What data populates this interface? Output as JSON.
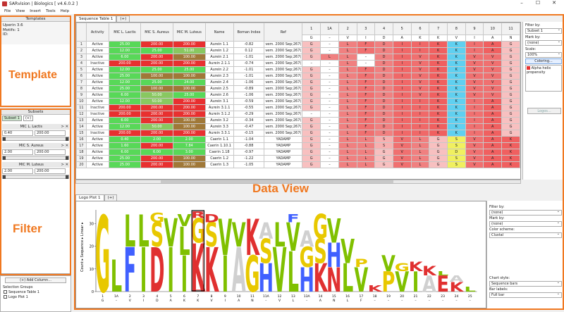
{
  "window": {
    "title": "SARvision | Biologics [ v4.6.0.2 ]",
    "min": "–",
    "max": "☐",
    "close": "✕"
  },
  "menu": [
    "File",
    "View",
    "Insert",
    "Tools",
    "Help"
  ],
  "templates": {
    "header": "Templates",
    "lines": [
      "Uperin 3.6",
      "Motifs: 1",
      "ID:"
    ]
  },
  "subsets": {
    "header": "Subsets",
    "active": "Subset 1",
    "plus": "(+)",
    "filters": [
      {
        "label": "MIC L. Lactis",
        "min": "0.40",
        "max": "200.00",
        "lo": 0.0,
        "hi": 1.0
      },
      {
        "label": "MIC S. Aureus",
        "min": "2.00",
        "max": "200.00",
        "lo": 0.0,
        "hi": 1.0
      },
      {
        "label": "MIC M. Luteus",
        "min": "2.00",
        "max": "200.00",
        "lo": 0.0,
        "hi": 1.0
      }
    ]
  },
  "add_column": "(+) Add Column...",
  "selection": {
    "header": "Selection Groups",
    "items": [
      "Sequence Table 1",
      "Logo Plot 1"
    ]
  },
  "annotations": {
    "template": "Template",
    "filter": "Filter",
    "dataview": "Data View"
  },
  "table_tab": "Sequence Table 1",
  "table_plus": "(+)",
  "table": {
    "headers": [
      "Activity",
      "MIC L. Lactis",
      "MIC S. Aureus",
      "MIC M. Luteus",
      "Name",
      "Boman Index",
      "Ref"
    ],
    "pos": [
      "1",
      "1A",
      "2",
      "3",
      "4",
      "5",
      "6",
      "7",
      "8",
      "9",
      "10",
      "11"
    ],
    "consensus": [
      "G",
      "–",
      "V",
      "I",
      "D",
      "A",
      "K",
      "K",
      "V",
      "I",
      "A",
      "N"
    ],
    "rows": [
      [
        "1",
        "Active",
        "25.00",
        "200.00",
        "200.00",
        "Aurein 1.1",
        "-0.82",
        "vem. 2000 Sep;267(",
        "G",
        "–",
        "L",
        "F",
        "D",
        "I",
        "I",
        "K",
        "K",
        "I",
        "A",
        "G"
      ],
      [
        "2",
        "Active",
        "12.00",
        "25.00",
        "51.00",
        "Aurein 1.2",
        "0.12",
        "vem. 2000 Sep;267(",
        "G",
        "–",
        "L",
        "F",
        "D",
        "I",
        "I",
        "K",
        "K",
        "I",
        "A",
        "G"
      ],
      [
        "3",
        "Active",
        "6.00",
        "200.00",
        "100.00",
        "Aurein 2.1",
        "-1.01",
        "vem. 2000 Sep;267(",
        "G",
        "L",
        "L",
        "–",
        "D",
        "I",
        "V",
        "K",
        "K",
        "V",
        "V",
        "G"
      ],
      [
        "4",
        "Inactive",
        "200.00",
        "200.00",
        "200.00",
        "Aurein 2.1.1",
        "-0.74",
        "vem. 2000 Sep;267(",
        "–",
        "–",
        "L",
        "–",
        "D",
        "I",
        "V",
        "K",
        "K",
        "V",
        "V",
        "G"
      ],
      [
        "5",
        "Active",
        "12.00",
        "25.00",
        "25.00",
        "Aurein 2.2",
        "-1.01",
        "vem. 2000 Sep;267(",
        "G",
        "–",
        "L",
        "F",
        "D",
        "I",
        "V",
        "K",
        "K",
        "V",
        "V",
        "G"
      ],
      [
        "6",
        "Active",
        "25.00",
        "100.00",
        "100.00",
        "Aurein 2.3",
        "-1.01",
        "vem. 2000 Sep;267(",
        "G",
        "–",
        "L",
        "F",
        "D",
        "I",
        "V",
        "K",
        "K",
        "V",
        "V",
        "G"
      ],
      [
        "7",
        "Active",
        "12.00",
        "25.00",
        "24.00",
        "Aurein 2.4",
        "-1.06",
        "vem. 2000 Sep;267(",
        "G",
        "–",
        "L",
        "F",
        "D",
        "I",
        "V",
        "K",
        "K",
        "V",
        "V",
        "G"
      ],
      [
        "8",
        "Active",
        "25.00",
        "100.00",
        "100.00",
        "Aurein 2.5",
        "-0.89",
        "vem. 2000 Sep;267(",
        "G",
        "–",
        "L",
        "F",
        "D",
        "I",
        "V",
        "K",
        "K",
        "V",
        "V",
        "G"
      ],
      [
        "9",
        "Active",
        "6.00",
        "50.00",
        "25.00",
        "Aurein 2.6",
        "-1.06",
        "vem. 2000 Sep;267(",
        "G",
        "–",
        "L",
        "F",
        "D",
        "I",
        "V",
        "K",
        "K",
        "V",
        "V",
        "G"
      ],
      [
        "10",
        "Active",
        "12.00",
        "50.00",
        "200.00",
        "Aurein 3.1",
        "-0.59",
        "vem. 2000 Sep;267(",
        "G",
        "–",
        "L",
        "F",
        "D",
        "I",
        "I",
        "K",
        "K",
        "I",
        "A",
        "G"
      ],
      [
        "11",
        "Inactive",
        "200.00",
        "200.00",
        "200.00",
        "Aurein 3.1.1",
        "-0.55",
        "vem. 2000 Sep;267(",
        "G",
        "–",
        "L",
        "F",
        "D",
        "I",
        "I",
        "K",
        "K",
        "I",
        "A",
        "G"
      ],
      [
        "12",
        "Inactive",
        "200.00",
        "200.00",
        "200.00",
        "Aurein 3.1.2",
        "-0.29",
        "vem. 2000 Sep;267(",
        "–",
        "–",
        "L",
        "F",
        "D",
        "I",
        "I",
        "K",
        "K",
        "I",
        "A",
        "G"
      ],
      [
        "13",
        "Active",
        "6.00",
        "200.00",
        "100.00",
        "Aurein 3.2",
        "-0.34",
        "vem. 2000 Sep;267(",
        "G",
        "–",
        "L",
        "F",
        "D",
        "I",
        "I",
        "K",
        "K",
        "I",
        "A",
        "G"
      ],
      [
        "14",
        "Active",
        "12.00",
        "50.00",
        "100.00",
        "Aurein 3.3",
        "-0.47",
        "vem. 2000 Sep;267(",
        "G",
        "–",
        "L",
        "F",
        "D",
        "I",
        "I",
        "K",
        "K",
        "I",
        "A",
        "G"
      ],
      [
        "15",
        "Inactive",
        "200.00",
        "200.00",
        "200.00",
        "Aurein 3.3.1",
        "-0.15",
        "vem. 2000 Sep;267(",
        "G",
        "–",
        "L",
        "F",
        "D",
        "I",
        "I",
        "K",
        "K",
        "I",
        "A",
        "G"
      ],
      [
        "16",
        "Active",
        "0.40",
        "2.00",
        "2.00",
        "Caerin 1.1",
        "-1.04",
        "YADAMP",
        "G",
        "–",
        "L",
        "L",
        "S",
        "V",
        "L",
        "G",
        "S",
        "V",
        "A",
        "K"
      ],
      [
        "17",
        "Active",
        "1.60",
        "200.00",
        "7.84",
        "Caerin 1.10.1",
        "-0.88",
        "YADAMP",
        "G",
        "–",
        "L",
        "L",
        "S",
        "V",
        "L",
        "G",
        "S",
        "V",
        "A",
        "K"
      ],
      [
        "18",
        "Active",
        "6.00",
        "6.00",
        "3.00",
        "Caerin 1.18",
        "-0.97",
        "YADAMP",
        "G",
        "–",
        "L",
        "L",
        "G",
        "V",
        "L",
        "G",
        "D",
        "V",
        "A",
        "K"
      ],
      [
        "19",
        "Active",
        "25.00",
        "200.00",
        "100.00",
        "Caerin 1.2",
        "-1.22",
        "YADAMP",
        "G",
        "–",
        "L",
        "L",
        "G",
        "V",
        "L",
        "G",
        "S",
        "V",
        "A",
        "K"
      ],
      [
        "20",
        "Active",
        "25.00",
        "200.00",
        "100.00",
        "Caerin 1.3",
        "-1.05",
        "YADAMP",
        "G",
        "–",
        "L",
        "L",
        "G",
        "V",
        "L",
        "G",
        "S",
        "V",
        "A",
        "K"
      ]
    ]
  },
  "table_panel": {
    "filter_by": "Filter by:",
    "subset": "Subset 1",
    "mark_by": "Mark by:",
    "mark": "(none)",
    "scale": "Scale:",
    "scale_val": "100%",
    "coloring": "Coloring...",
    "legend": "Alpha helix propensity",
    "logos": "Logos..."
  },
  "logo_tab": "Logo Plot 1",
  "logo_plus": "(+)",
  "logo": {
    "ylabel": "Count ▸ Sequence ▸ Linear ▸",
    "yticks": [
      "0",
      "10",
      "20",
      "30"
    ],
    "positions": [
      "1",
      "1A",
      "2",
      "3",
      "4",
      "5",
      "6",
      "7",
      "8",
      "9",
      "10",
      "11",
      "11A",
      "12",
      "13",
      "13A",
      "14",
      "15",
      "16",
      "17",
      "18",
      "19",
      "20",
      "21",
      "22",
      "23",
      "24",
      "25"
    ],
    "consensus": [
      "G",
      "–",
      "V",
      "I",
      "D",
      "A",
      "K",
      "K",
      "V",
      "I",
      "A",
      "N",
      "–",
      "V",
      "L",
      "–",
      "A",
      "N",
      "L",
      "F",
      "–",
      "–",
      "–",
      "–",
      "–",
      "–",
      "–",
      "–"
    ],
    "columns": [
      [
        [
          "G",
          0.95,
          "#e8c800"
        ]
      ],
      [
        [
          "L",
          0.4,
          "#80c000"
        ]
      ],
      [
        [
          "F",
          0.55,
          "#4060ff"
        ],
        [
          "L",
          0.4,
          "#80c000"
        ]
      ],
      [
        [
          "I",
          0.55,
          "#80c000"
        ],
        [
          "L",
          0.4,
          "#80c000"
        ]
      ],
      [
        [
          "D",
          0.55,
          "#e03030"
        ],
        [
          "S",
          0.3,
          "#e8c800"
        ],
        [
          "G",
          0.12,
          "#e8c800"
        ]
      ],
      [
        [
          "I",
          0.55,
          "#80c000"
        ],
        [
          "V",
          0.35,
          "#80c000"
        ]
      ],
      [
        [
          "I",
          0.45,
          "#80c000"
        ],
        [
          "L",
          0.35,
          "#80c000"
        ],
        [
          "V",
          0.15,
          "#80c000"
        ]
      ],
      [
        [
          "K",
          0.6,
          "#e03030"
        ],
        [
          "G",
          0.3,
          "#e8c800"
        ],
        [
          "R",
          0.08,
          "#e03030"
        ]
      ],
      [
        [
          "K",
          0.55,
          "#e03030"
        ],
        [
          "S",
          0.3,
          "#e8c800"
        ],
        [
          "D",
          0.1,
          "#e03030"
        ]
      ],
      [
        [
          "I",
          0.45,
          "#80c000"
        ],
        [
          "V",
          0.45,
          "#80c000"
        ]
      ],
      [
        [
          "A",
          0.55,
          "#d0d0d0"
        ],
        [
          "V",
          0.3,
          "#80c000"
        ]
      ],
      [
        [
          "G",
          0.45,
          "#e8c800"
        ],
        [
          "K",
          0.45,
          "#e03030"
        ]
      ],
      [
        [
          "H",
          0.35,
          "#4060ff"
        ],
        [
          "S",
          0.3,
          "#e8c800"
        ],
        [
          "A",
          0.2,
          "#d0d0d0"
        ]
      ],
      [
        [
          "V",
          0.55,
          "#80c000"
        ],
        [
          "L",
          0.3,
          "#80c000"
        ]
      ],
      [
        [
          "L",
          0.5,
          "#80c000"
        ],
        [
          "V",
          0.35,
          "#80c000"
        ],
        [
          "F",
          0.1,
          "#4060ff"
        ]
      ],
      [
        [
          "H",
          0.3,
          "#4060ff"
        ],
        [
          "G",
          0.25,
          "#e8c800"
        ],
        [
          "A",
          0.2,
          "#d0d0d0"
        ]
      ],
      [
        [
          "K",
          0.35,
          "#e03030"
        ],
        [
          "S",
          0.3,
          "#e8c800"
        ],
        [
          "G",
          0.3,
          "#e8c800"
        ]
      ],
      [
        [
          "N",
          0.3,
          "#e03030"
        ],
        [
          "H",
          0.3,
          "#4060ff"
        ],
        [
          "V",
          0.3,
          "#80c000"
        ]
      ],
      [
        [
          "L",
          0.35,
          "#80c000"
        ],
        [
          "V",
          0.3,
          "#80c000"
        ]
      ],
      [
        [
          "V",
          0.3,
          "#80c000"
        ],
        [
          "P",
          0.1,
          "#e8c800"
        ]
      ],
      [
        [
          "K",
          0.08,
          "#e03030"
        ]
      ],
      [
        [
          "P",
          0.25,
          "#e8c800"
        ],
        [
          "V",
          0.2,
          "#80c000"
        ]
      ],
      [
        [
          "V",
          0.25,
          "#80c000"
        ],
        [
          "G",
          0.1,
          "#e8c800"
        ]
      ],
      [
        [
          "I",
          0.25,
          "#80c000"
        ],
        [
          "K",
          0.12,
          "#e03030"
        ]
      ],
      [
        [
          "A",
          0.2,
          "#d0d0d0"
        ],
        [
          "K",
          0.12,
          "#e03030"
        ]
      ],
      [
        [
          "E",
          0.2,
          "#e03030"
        ],
        [
          "L",
          0.05,
          "#80c000"
        ]
      ],
      [
        [
          "K",
          0.12,
          "#e03030"
        ],
        [
          "A",
          0.08,
          "#d0d0d0"
        ]
      ],
      [
        [
          "L",
          0.06,
          "#80c000"
        ]
      ]
    ]
  },
  "logo_panel": {
    "filter_by": "Filter by:",
    "filter": "(none)",
    "mark_by": "Mark by:",
    "mark": "(none)",
    "color_scheme": "Color scheme:",
    "scheme": "Clustal",
    "chart_style": "Chart style:",
    "style": "Sequence bars",
    "bar_labels": "Bar labels:",
    "labels": "Full bar"
  },
  "colors": {
    "accent": "#f07820",
    "green": "#58d858",
    "red": "#e83030",
    "brown": "#a07838",
    "inactive": "#c02828"
  }
}
